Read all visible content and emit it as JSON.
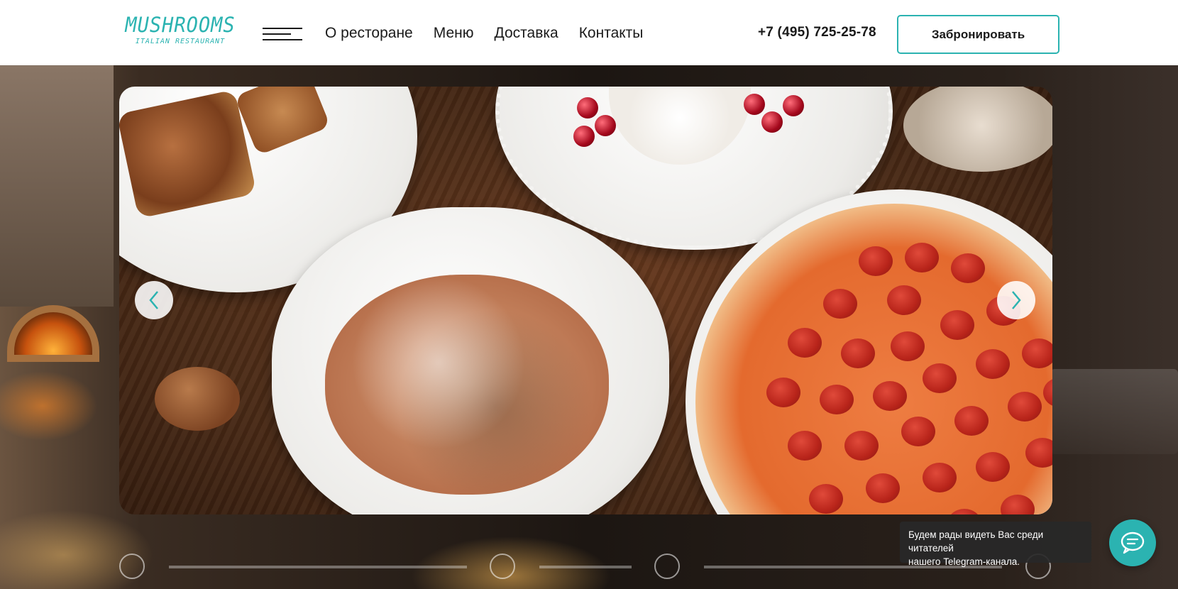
{
  "header": {
    "logo": {
      "name": "MUSHROOMS",
      "tagline": "ITALIAN RESTAURANT"
    },
    "nav": [
      {
        "label": "О ресторане"
      },
      {
        "label": "Меню"
      },
      {
        "label": "Доставка"
      },
      {
        "label": "Контакты"
      }
    ],
    "phone": "+7 (495) 725-25-78",
    "book_label": "Забронировать"
  },
  "slider": {
    "icons": {
      "prev": "chevron-left-icon",
      "next": "chevron-right-icon"
    }
  },
  "telegram_tip": {
    "line1": "Будем рады видеть Вас среди читателей",
    "line2": "нашего Telegram-канала."
  },
  "chat": {
    "icon": "chat-bubble-icon"
  },
  "colors": {
    "accent": "#2bb3b1",
    "text": "#1a1a1a",
    "header_bg": "#ffffff"
  }
}
